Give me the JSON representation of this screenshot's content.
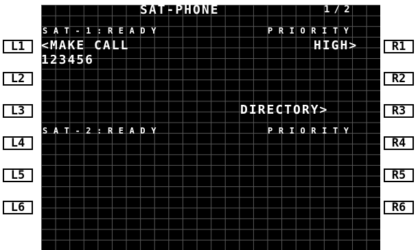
{
  "page_title": "SAT-PHONE",
  "page_number": "1/2",
  "sat1": {
    "status_label": "SAT-1:READY",
    "priority_label": "PRIORITY",
    "action": "<MAKE CALL",
    "priority_value": "HIGH>",
    "number": "123456"
  },
  "directory": "DIRECTORY>",
  "sat2": {
    "status_label": "SAT-2:READY",
    "priority_label": "PRIORITY"
  },
  "line_select_keys": {
    "left": [
      "L1",
      "L2",
      "L3",
      "L4",
      "L5",
      "L6"
    ],
    "right": [
      "R1",
      "R2",
      "R3",
      "R4",
      "R5",
      "R6"
    ]
  },
  "colors": {
    "screen_background": "#000000",
    "grid_line": "#5a5a5a",
    "text": "#ffffff",
    "key_background": "#ffffff",
    "key_border": "#000000"
  }
}
